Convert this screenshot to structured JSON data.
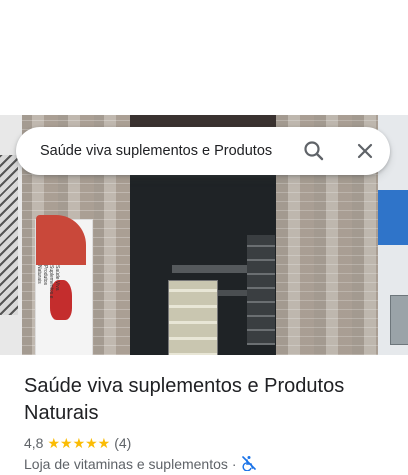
{
  "search": {
    "query": "Saúde viva suplementos e Produtos",
    "icon_search": "search-icon",
    "icon_close": "close-icon"
  },
  "photo": {
    "banner_text": "Saúde Viva Suplementos e Produtos Naturais"
  },
  "place": {
    "name": "Saúde viva suplementos e Produtos Naturais",
    "rating_value": "4,8",
    "rating_stars": "★★★★★",
    "rating_fraction": 0.96,
    "review_count": "(4)",
    "category": "Loja de vitaminas e suplementos",
    "separator": "·",
    "accessibility_icon": "no-wheelchair-access-icon"
  },
  "colors": {
    "star": "#fbbc04",
    "accessibility": "#1a73e8",
    "text_primary": "#202124",
    "text_secondary": "#5f6368"
  }
}
